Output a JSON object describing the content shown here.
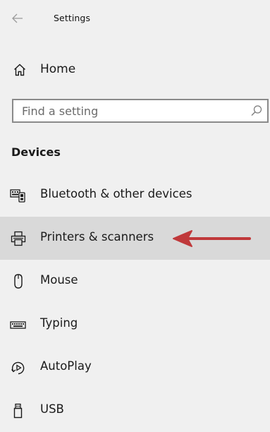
{
  "window": {
    "title": "Settings"
  },
  "home": {
    "label": "Home"
  },
  "search": {
    "placeholder": "Find a setting",
    "value": ""
  },
  "section": {
    "heading": "Devices"
  },
  "nav": {
    "items": [
      {
        "label": "Bluetooth & other devices",
        "icon": "bluetooth-devices-icon",
        "selected": false
      },
      {
        "label": "Printers & scanners",
        "icon": "printer-icon",
        "selected": true
      },
      {
        "label": "Mouse",
        "icon": "mouse-icon",
        "selected": false
      },
      {
        "label": "Typing",
        "icon": "keyboard-icon",
        "selected": false
      },
      {
        "label": "AutoPlay",
        "icon": "autoplay-icon",
        "selected": false
      },
      {
        "label": "USB",
        "icon": "usb-icon",
        "selected": false
      }
    ]
  },
  "annotation": {
    "arrow_color": "#c0393b"
  },
  "colors": {
    "background": "#f0f0f0",
    "selected_background": "#d9d9d9",
    "search_border": "#8a8a8a"
  }
}
